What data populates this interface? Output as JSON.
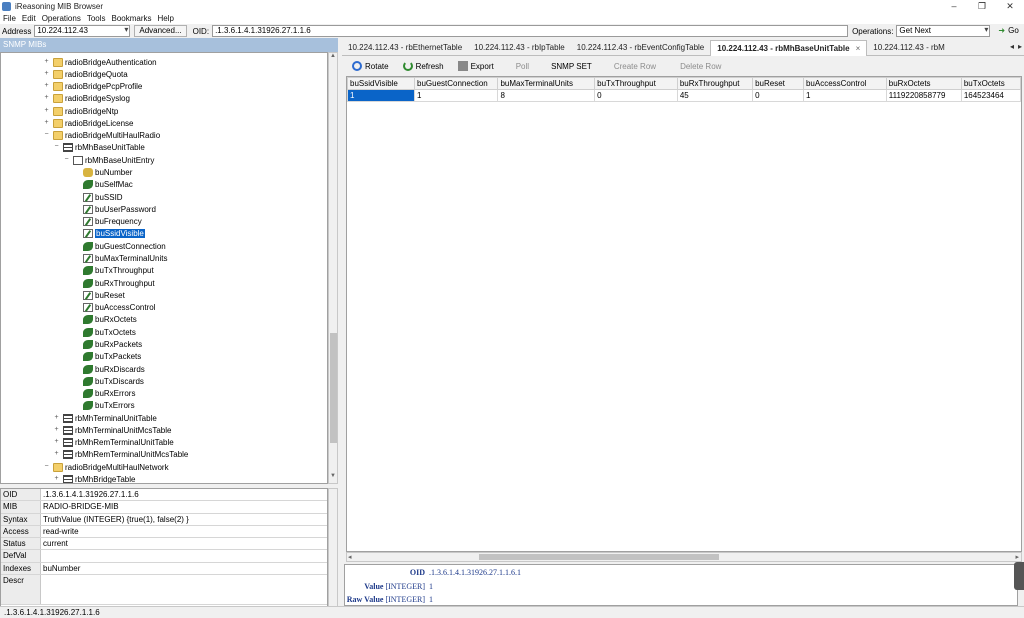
{
  "window": {
    "title": "iReasoning MIB Browser",
    "controls": [
      "–",
      "❐",
      "✕"
    ]
  },
  "menu": [
    "File",
    "Edit",
    "Operations",
    "Tools",
    "Bookmarks",
    "Help"
  ],
  "addressbar": {
    "address_label": "Address",
    "address_value": "10.224.112.43",
    "advanced_label": "Advanced...",
    "oid_label": "OID:",
    "oid_value": ".1.3.6.1.4.1.31926.27.1.1.6",
    "operations_label": "Operations:",
    "operations_value": "Get Next",
    "go_label": "Go"
  },
  "left": {
    "header": "SNMP MIBs",
    "tree": [
      {
        "label": "radioBridgeAuthentication",
        "icon": "folder-icon",
        "level": 0,
        "exp": "+"
      },
      {
        "label": "radioBridgeQuota",
        "icon": "folder-icon",
        "level": 0,
        "exp": "+"
      },
      {
        "label": "radioBridgePcpProfile",
        "icon": "folder-icon",
        "level": 0,
        "exp": "+"
      },
      {
        "label": "radioBridgeSyslog",
        "icon": "folder-icon",
        "level": 0,
        "exp": "+"
      },
      {
        "label": "radioBridgeNtp",
        "icon": "folder-icon",
        "level": 0,
        "exp": "+"
      },
      {
        "label": "radioBridgeLicense",
        "icon": "folder-icon",
        "level": 0,
        "exp": "+"
      },
      {
        "label": "radioBridgeMultiHaulRadio",
        "icon": "folder-icon",
        "level": 0,
        "exp": "−"
      },
      {
        "label": "rbMhBaseUnitTable",
        "icon": "table-icon",
        "level": 1,
        "exp": "−"
      },
      {
        "label": "rbMhBaseUnitEntry",
        "icon": "entry-icon",
        "level": 2,
        "exp": "−"
      },
      {
        "label": "buNumber",
        "icon": "key-icon",
        "level": 3,
        "exp": ""
      },
      {
        "label": "buSelfMac",
        "icon": "leaf-icon",
        "level": 3,
        "exp": ""
      },
      {
        "label": "buSSID",
        "icon": "edit-icon",
        "level": 3,
        "exp": ""
      },
      {
        "label": "buUserPassword",
        "icon": "edit-icon",
        "level": 3,
        "exp": ""
      },
      {
        "label": "buFrequency",
        "icon": "edit-icon",
        "level": 3,
        "exp": ""
      },
      {
        "label": "buSsidVisible",
        "icon": "edit-icon",
        "level": 3,
        "exp": "",
        "selected": true
      },
      {
        "label": "buGuestConnection",
        "icon": "leaf-icon",
        "level": 3,
        "exp": ""
      },
      {
        "label": "buMaxTerminalUnits",
        "icon": "edit-icon",
        "level": 3,
        "exp": ""
      },
      {
        "label": "buTxThroughput",
        "icon": "leaf-icon",
        "level": 3,
        "exp": ""
      },
      {
        "label": "buRxThroughput",
        "icon": "leaf-icon",
        "level": 3,
        "exp": ""
      },
      {
        "label": "buReset",
        "icon": "edit-icon",
        "level": 3,
        "exp": ""
      },
      {
        "label": "buAccessControl",
        "icon": "edit-icon",
        "level": 3,
        "exp": ""
      },
      {
        "label": "buRxOctets",
        "icon": "leaf-icon",
        "level": 3,
        "exp": ""
      },
      {
        "label": "buTxOctets",
        "icon": "leaf-icon",
        "level": 3,
        "exp": ""
      },
      {
        "label": "buRxPackets",
        "icon": "leaf-icon",
        "level": 3,
        "exp": ""
      },
      {
        "label": "buTxPackets",
        "icon": "leaf-icon",
        "level": 3,
        "exp": ""
      },
      {
        "label": "buRxDiscards",
        "icon": "leaf-icon",
        "level": 3,
        "exp": ""
      },
      {
        "label": "buTxDiscards",
        "icon": "leaf-icon",
        "level": 3,
        "exp": ""
      },
      {
        "label": "buRxErrors",
        "icon": "leaf-icon",
        "level": 3,
        "exp": ""
      },
      {
        "label": "buTxErrors",
        "icon": "leaf-icon",
        "level": 3,
        "exp": ""
      },
      {
        "label": "rbMhTerminalUnitTable",
        "icon": "table-icon",
        "level": 1,
        "exp": "+"
      },
      {
        "label": "rbMhTerminalUnitMcsTable",
        "icon": "table-icon",
        "level": 1,
        "exp": "+"
      },
      {
        "label": "rbMhRemTerminalUnitTable",
        "icon": "table-icon",
        "level": 1,
        "exp": "+"
      },
      {
        "label": "rbMhRemTerminalUnitMcsTable",
        "icon": "table-icon",
        "level": 1,
        "exp": "+"
      },
      {
        "label": "radioBridgeMultiHaulNetwork",
        "icon": "folder-icon",
        "level": 0,
        "exp": "−"
      },
      {
        "label": "rbMhBridgeTable",
        "icon": "table-icon",
        "level": 1,
        "exp": "+"
      }
    ],
    "properties": [
      {
        "key": "OID",
        "value": ".1.3.6.1.4.1.31926.27.1.1.6"
      },
      {
        "key": "MIB",
        "value": "RADIO-BRIDGE-MIB"
      },
      {
        "key": "Syntax",
        "value": "TruthValue (INTEGER) {true(1), false(2) }"
      },
      {
        "key": "Access",
        "value": "read-write"
      },
      {
        "key": "Status",
        "value": "current"
      },
      {
        "key": "DefVal",
        "value": ""
      },
      {
        "key": "Indexes",
        "value": "buNumber"
      },
      {
        "key": "Descr",
        "value": ""
      }
    ]
  },
  "right": {
    "tabs": [
      {
        "label": "10.224.112.43 - rbEthernetTable",
        "active": false
      },
      {
        "label": "10.224.112.43 - rbIpTable",
        "active": false
      },
      {
        "label": "10.224.112.43 - rbEventConfigTable",
        "active": false
      },
      {
        "label": "10.224.112.43 - rbMhBaseUnitTable",
        "active": true,
        "close": "×"
      },
      {
        "label": "10.224.112.43 - rbM",
        "active": false
      }
    ],
    "toolbar": {
      "rotate": "Rotate",
      "refresh": "Refresh",
      "export": "Export",
      "poll": "Poll",
      "snmpset": "SNMP SET",
      "createrow": "Create Row",
      "deleterow": "Delete Row"
    },
    "table": {
      "columns": [
        "buSsidVisible",
        "buGuestConnection",
        "buMaxTerminalUnits",
        "buTxThroughput",
        "buRxThroughput",
        "buReset",
        "buAccessControl",
        "buRxOctets",
        "buTxOctets"
      ],
      "rows": [
        [
          "1",
          "1",
          "8",
          "0",
          "45",
          "0",
          "1",
          "1119220858779",
          "164523464"
        ]
      ]
    },
    "detail": {
      "oid_label": "OID",
      "oid_value": ".1.3.6.1.4.1.31926.27.1.1.6.1",
      "value_label": "Value",
      "value_type": "[INTEGER]",
      "value": "1",
      "raw_label": "Raw Value",
      "raw_type": "[INTEGER]",
      "raw_value": "1"
    }
  },
  "status": ".1.3.6.1.4.1.31926.27.1.1.6"
}
